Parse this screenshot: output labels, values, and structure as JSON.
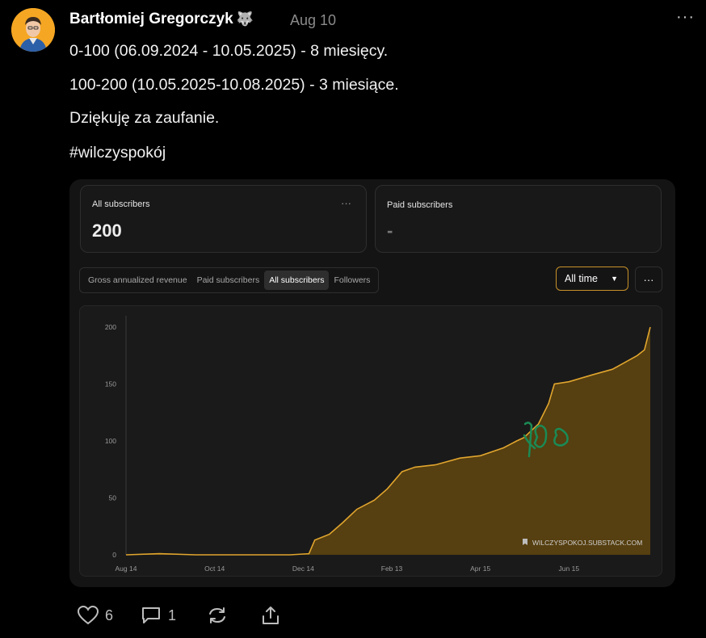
{
  "post": {
    "author": "Bartłomiej Gregorczyk",
    "author_emoji": "🐺",
    "date": "Aug 10",
    "more_label": "···",
    "lines": [
      "0-100 (06.09.2024 - 10.05.2025) - 8 miesięcy.",
      "100-200 (10.05.2025-10.08.2025) - 3 miesiące.",
      "Dziękuję za zaufanie.",
      "#wilczyspokój"
    ]
  },
  "stats": {
    "all_label": "All subscribers",
    "all_value": "200",
    "paid_label": "Paid subscribers",
    "paid_value": "-",
    "menu": "···"
  },
  "tabs": [
    "Gross annualized revenue",
    "Paid subscribers",
    "All subscribers",
    "Followers"
  ],
  "active_tab": "All subscribers",
  "range_select": {
    "value": "All time",
    "caret": "▼"
  },
  "more_button": "···",
  "watermark": "WILCZYSPOKOJ.SUBSTACK.COM",
  "annotation": "100",
  "colors": {
    "accent": "#e0a52e",
    "fill": "#5a4110",
    "handwriting": "#1b8a55"
  },
  "actions": {
    "likes": "6",
    "comments": "1"
  },
  "icons": [
    "heart-icon",
    "comment-icon",
    "restack-icon",
    "share-icon",
    "wolf-icon",
    "bookmark-icon"
  ],
  "chart_data": {
    "type": "area",
    "x_ticks": [
      "Aug 14",
      "Oct 14",
      "Dec 14",
      "Feb 13",
      "Apr 15",
      "Jun 15"
    ],
    "y_ticks": [
      "0",
      "50",
      "100",
      "150",
      "200"
    ],
    "ylim": [
      0,
      200
    ],
    "grid": false,
    "points": [
      [
        "2024-08-14",
        0
      ],
      [
        "2024-09-06",
        1
      ],
      [
        "2024-10-01",
        0
      ],
      [
        "2024-11-01",
        0
      ],
      [
        "2024-12-05",
        0
      ],
      [
        "2024-12-18",
        1
      ],
      [
        "2024-12-22",
        13
      ],
      [
        "2025-01-01",
        18
      ],
      [
        "2025-01-10",
        28
      ],
      [
        "2025-01-20",
        40
      ],
      [
        "2025-02-01",
        48
      ],
      [
        "2025-02-10",
        58
      ],
      [
        "2025-02-20",
        73
      ],
      [
        "2025-03-01",
        77
      ],
      [
        "2025-03-15",
        79
      ],
      [
        "2025-04-01",
        85
      ],
      [
        "2025-04-15",
        87
      ],
      [
        "2025-05-01",
        94
      ],
      [
        "2025-05-10",
        100
      ],
      [
        "2025-05-15",
        103
      ],
      [
        "2025-05-25",
        115
      ],
      [
        "2025-06-01",
        133
      ],
      [
        "2025-06-05",
        150
      ],
      [
        "2025-06-15",
        152
      ],
      [
        "2025-07-01",
        158
      ],
      [
        "2025-07-15",
        163
      ],
      [
        "2025-07-25",
        170
      ],
      [
        "2025-08-01",
        175
      ],
      [
        "2025-08-06",
        180
      ],
      [
        "2025-08-10",
        200
      ]
    ]
  }
}
